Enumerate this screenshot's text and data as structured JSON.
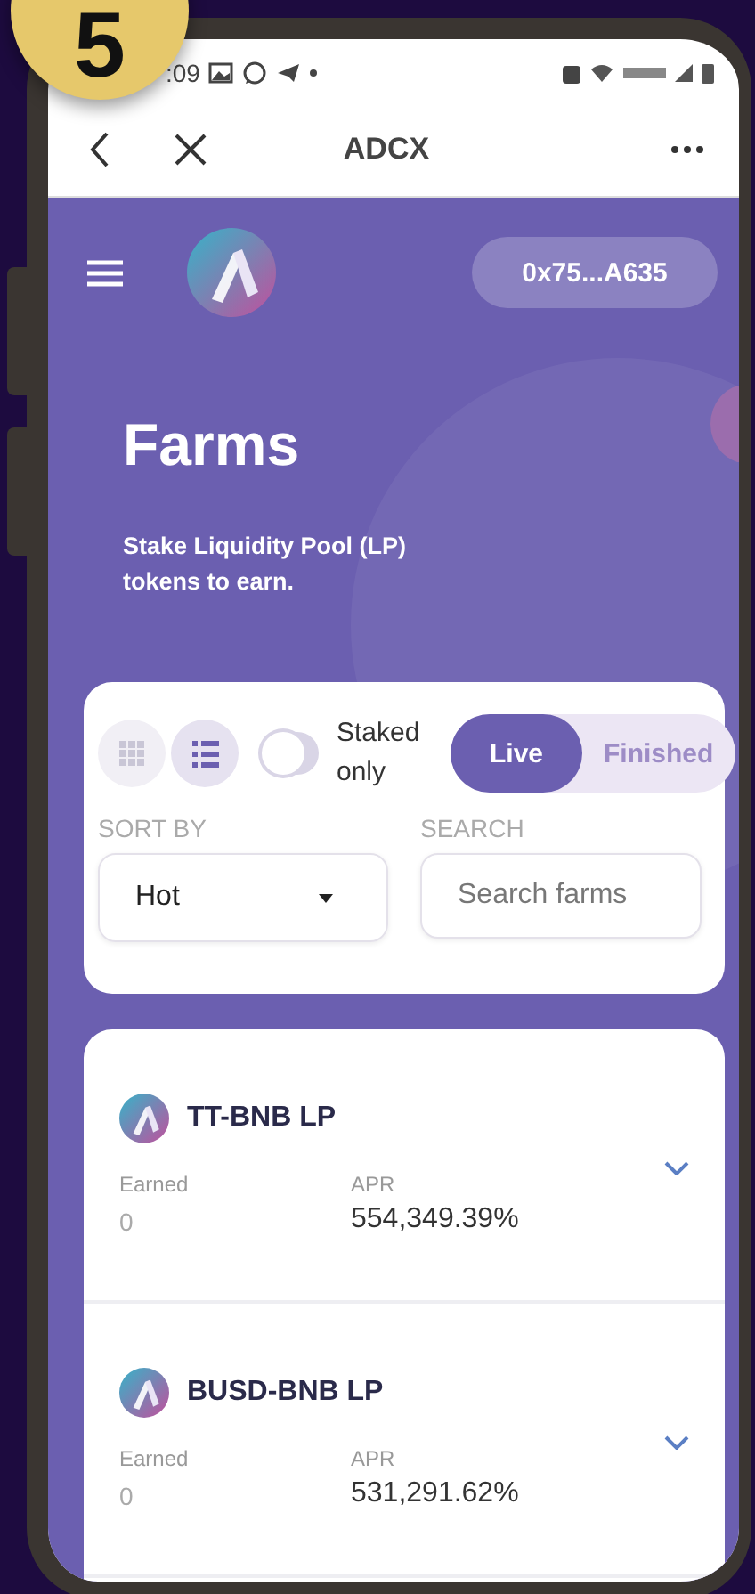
{
  "step_badge": "5",
  "status_bar": {
    "time": ":09"
  },
  "browser_bar": {
    "title": "ADCX"
  },
  "app_header": {
    "wallet_address": "0x75...A635"
  },
  "hero": {
    "title": "Farms",
    "subtitle": "Stake Liquidity Pool (LP) tokens to earn."
  },
  "filters": {
    "view_modes": [
      {
        "kind": "grid",
        "selected": false
      },
      {
        "kind": "list",
        "selected": true
      }
    ],
    "staked_only": {
      "label": "Staked only",
      "on": false
    },
    "status_tabs": [
      {
        "label": "Live",
        "selected": true
      },
      {
        "label": "Finished",
        "selected": false
      }
    ],
    "sort": {
      "label": "SORT BY",
      "value": "Hot"
    },
    "search": {
      "label": "SEARCH",
      "placeholder": "Search farms"
    }
  },
  "farms": [
    {
      "name": "TT-BNB LP",
      "earned_label": "Earned",
      "earned": "0",
      "apr_label": "APR",
      "apr": "554,349.39%"
    },
    {
      "name": "BUSD-BNB LP",
      "earned_label": "Earned",
      "earned": "0",
      "apr_label": "APR",
      "apr": "531,291.62%"
    }
  ]
}
